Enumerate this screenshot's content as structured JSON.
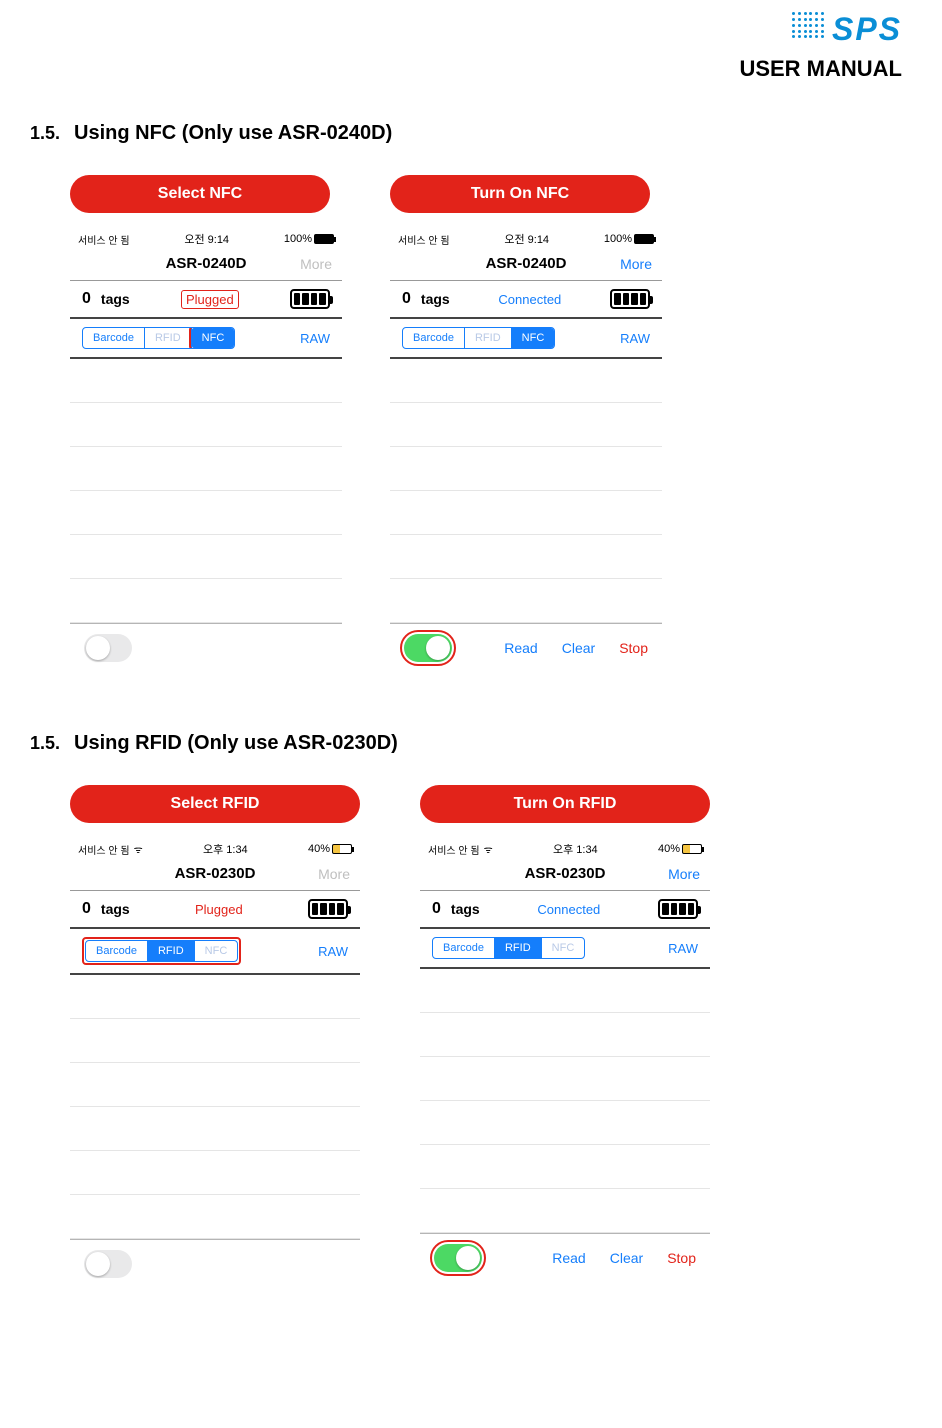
{
  "header": {
    "brand": "SPS",
    "manual": "USER MANUAL"
  },
  "section1": {
    "num": "1.5.",
    "title": "Using NFC (Only use ASR-0240D)",
    "left": {
      "pill": "Select NFC",
      "carrier": "서비스 안 됨",
      "time": "오전 9:14",
      "battery_pct": "100%",
      "nav_title": "ASR-0240D",
      "more": "More",
      "count": "0",
      "tags": "tags",
      "status": "Plugged",
      "seg": {
        "barcode": "Barcode",
        "rfid": "RFID",
        "nfc": "NFC"
      },
      "raw": "RAW"
    },
    "right": {
      "pill": "Turn On  NFC",
      "carrier": "서비스 안 됨",
      "time": "오전 9:14",
      "battery_pct": "100%",
      "nav_title": "ASR-0240D",
      "more": "More",
      "count": "0",
      "tags": "tags",
      "status": "Connected",
      "seg": {
        "barcode": "Barcode",
        "rfid": "RFID",
        "nfc": "NFC"
      },
      "raw": "RAW",
      "actions": {
        "read": "Read",
        "clear": "Clear",
        "stop": "Stop"
      }
    }
  },
  "section2": {
    "num": "1.5.",
    "title": "Using RFID (Only use ASR-0230D)",
    "left": {
      "pill": "Select RFID",
      "carrier": "서비스 안 됨",
      "wifi": "ᯤ",
      "time": "오후 1:34",
      "battery_pct": "40%",
      "nav_title": "ASR-0230D",
      "more": "More",
      "count": "0",
      "tags": "tags",
      "status": "Plugged",
      "seg": {
        "barcode": "Barcode",
        "rfid": "RFID",
        "nfc": "NFC"
      },
      "raw": "RAW"
    },
    "right": {
      "pill": "Turn On  RFID",
      "carrier": "서비스 안 됨",
      "wifi": "ᯤ",
      "time": "오후 1:34",
      "battery_pct": "40%",
      "nav_title": "ASR-0230D",
      "more": "More",
      "count": "0",
      "tags": "tags",
      "status": "Connected",
      "seg": {
        "barcode": "Barcode",
        "rfid": "RFID",
        "nfc": "NFC"
      },
      "raw": "RAW",
      "actions": {
        "read": "Read",
        "clear": "Clear",
        "stop": "Stop"
      }
    }
  }
}
